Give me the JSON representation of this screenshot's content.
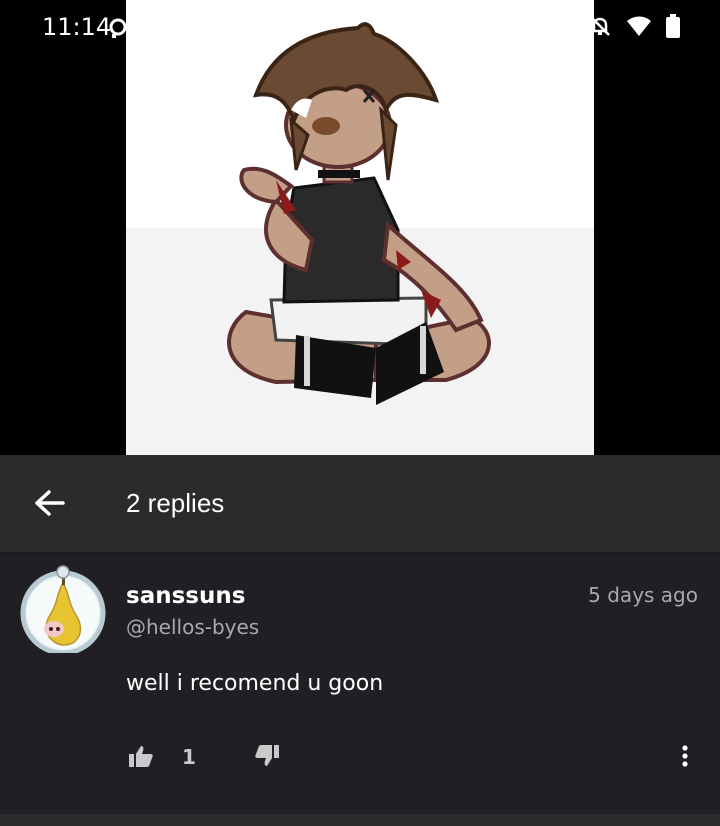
{
  "status_bar": {
    "time": "11:14",
    "icons": [
      "notification-search-icon",
      "bell-off-icon",
      "wifi-icon",
      "battery-icon"
    ]
  },
  "media": {
    "description_icon": "character-artwork"
  },
  "header": {
    "back_icon": "arrow-left-icon",
    "title": "2 replies"
  },
  "comment": {
    "username": "sanssuns",
    "handle": "@hellos-byes",
    "timestamp": "5 days ago",
    "text": "well i recomend u goon",
    "like_count": "1",
    "avatar_icon": "pear-avatar"
  },
  "colors": {
    "header_bg": "#2b2b2e",
    "comment_bg": "#202024",
    "secondary_text": "#a9a9ad"
  }
}
